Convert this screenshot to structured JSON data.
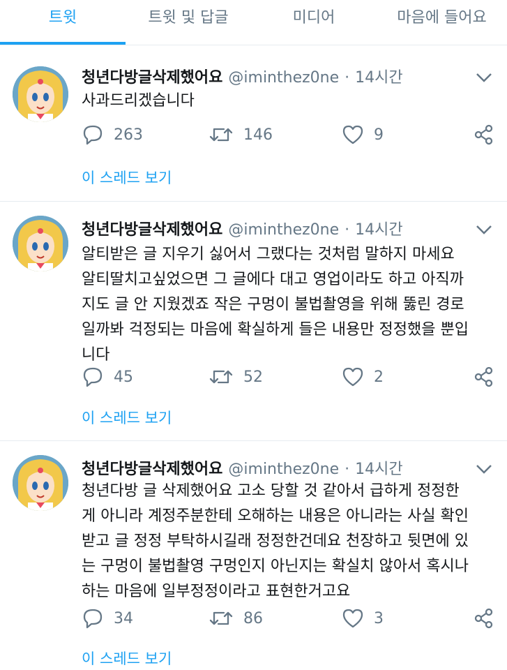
{
  "tabs": [
    "트윗",
    "트윗 및 답글",
    "미디어",
    "마음에 들어요"
  ],
  "colors": {
    "accent": "#1da1f2",
    "muted": "#657786",
    "text": "#14171a"
  },
  "tweets": [
    {
      "name": "청년다방글삭제했어요",
      "handle": "@iminthez0ne",
      "sep": "·",
      "time": "14시간",
      "text": "사과드리겠습니다",
      "replies": "263",
      "retweets": "146",
      "likes": "9",
      "thread": "이 스레드 보기"
    },
    {
      "name": "청년다방글삭제했어요",
      "handle": "@iminthez0ne",
      "sep": "·",
      "time": "14시간",
      "text": "알티받은 글 지우기 싫어서 그랬다는 것처럼 말하지 마세요\n알티딸치고싶었으면 그 글에다 대고 영업이라도 하고 아직까\n지도 글 안 지웠겠죠 작은 구멍이 불법촬영을 위해 뚫린 경로\n일까봐 걱정되는 마음에 확실하게 들은 내용만 정정했을 뿐입\n니다",
      "replies": "45",
      "retweets": "52",
      "likes": "2",
      "thread": "이 스레드 보기"
    },
    {
      "name": "청년다방글삭제했어요",
      "handle": "@iminthez0ne",
      "sep": "·",
      "time": "14시간",
      "text": "청년다방 글 삭제했어요 고소 당할 것 같아서 급하게 정정한\n게 아니라 계정주분한테 오해하는 내용은 아니라는 사실 확인\n받고 글 정정 부탁하시길래 정정한건데요 천장하고 뒷면에 있\n는 구멍이 불법촬영 구멍인지 아닌지는 확실치 않아서 혹시나\n하는 마음에 일부정정이라고 표현한거고요",
      "replies": "34",
      "retweets": "86",
      "likes": "3",
      "thread": "이 스레드 보기"
    }
  ]
}
